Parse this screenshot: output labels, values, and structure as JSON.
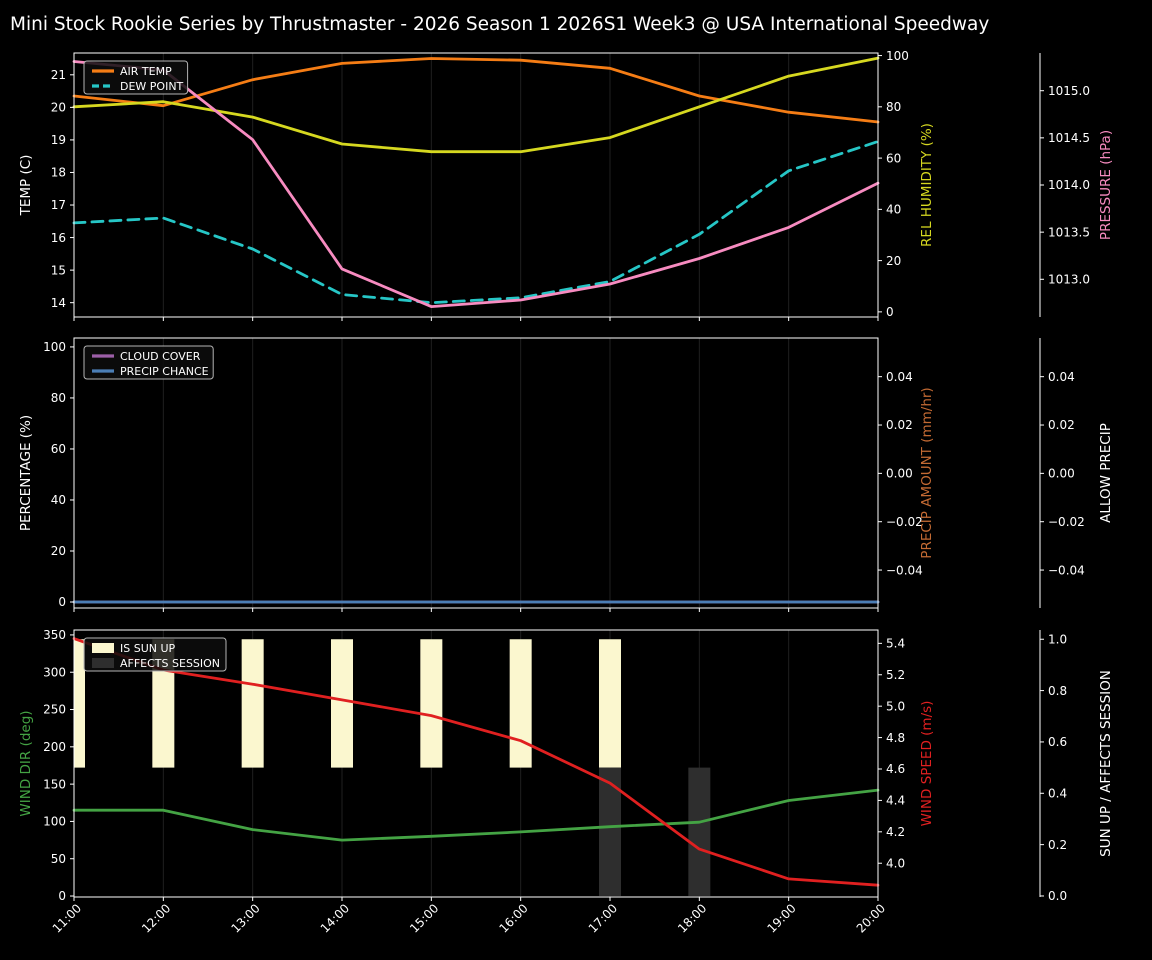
{
  "title": "Mini Stock Rookie Series by Thrustmaster - 2026 Season 1 2026S1 Week3 @ USA International Speedway",
  "x_axis": {
    "hours": [
      11,
      12,
      13,
      14,
      15,
      16,
      17,
      18,
      19,
      20
    ],
    "tick_labels": [
      "11:00",
      "12:00",
      "13:00",
      "14:00",
      "15:00",
      "16:00",
      "17:00",
      "18:00",
      "19:00",
      "20:00"
    ]
  },
  "colors": {
    "background": "#000000",
    "text": "#ffffff",
    "grid": "#202020",
    "spine": "#ffffff",
    "legend_bg": "#0d0d0d",
    "legend_border": "#b5b5b5",
    "air_temp": "#f57d15",
    "dew_point": "#26c6c6",
    "rel_humidity": "#d6d820",
    "pressure": "#f78bc0",
    "cloud_cover": "#9d5fa8",
    "precip_chance": "#4b7eb5",
    "precip_amount": "#c36a33",
    "wind_dir": "#44a344",
    "wind_speed": "#e02020",
    "is_sun_up": "#fbf7cf",
    "affects_session": "#2e2e2e"
  },
  "chart_data": [
    {
      "type": "line",
      "name": "temperature-panel",
      "axes": {
        "left": {
          "label": "TEMP (C)",
          "color_key": "text",
          "ticks": [
            14,
            15,
            16,
            17,
            18,
            19,
            20,
            21
          ],
          "range": [
            13.56,
            21.67
          ],
          "decimals": 0
        },
        "right_inner": {
          "label": "REL HUMIDITY (%)",
          "color_key": "rel_humidity",
          "ticks": [
            0,
            20,
            40,
            60,
            80,
            100
          ],
          "range": [
            -2,
            101
          ],
          "decimals": 0
        },
        "right_outer": {
          "label": "PRESSURE (hPa)",
          "color_key": "pressure",
          "ticks": [
            1013.0,
            1013.5,
            1014.0,
            1014.5,
            1015.0
          ],
          "range": [
            1012.6,
            1015.4
          ],
          "decimals": 1
        }
      },
      "series": [
        {
          "name": "AIR TEMP",
          "axis": "left",
          "color_key": "air_temp",
          "dash": false,
          "in_legend": true,
          "values": [
            20.35,
            20.05,
            20.85,
            21.35,
            21.5,
            21.45,
            21.2,
            20.35,
            19.85,
            19.55
          ]
        },
        {
          "name": "DEW POINT",
          "axis": "left",
          "color_key": "dew_point",
          "dash": true,
          "in_legend": true,
          "values": [
            16.45,
            16.6,
            15.65,
            14.25,
            14.0,
            14.15,
            14.65,
            16.1,
            18.05,
            18.95
          ]
        },
        {
          "name": "REL HUMIDITY",
          "axis": "right_inner",
          "color_key": "rel_humidity",
          "dash": false,
          "in_legend": false,
          "values": [
            80,
            82,
            76,
            65.5,
            62.5,
            62.5,
            68,
            80,
            92,
            99
          ]
        },
        {
          "name": "PRESSURE",
          "axis": "right_outer",
          "color_key": "pressure",
          "dash": false,
          "in_legend": false,
          "values": [
            1015.31,
            1015.22,
            1014.48,
            1013.11,
            1012.71,
            1012.78,
            1012.95,
            1013.22,
            1013.55,
            1014.02
          ]
        }
      ],
      "bars": []
    },
    {
      "type": "line",
      "name": "precipitation-panel",
      "axes": {
        "left": {
          "label": "PERCENTAGE (%)",
          "color_key": "text",
          "ticks": [
            0,
            20,
            40,
            60,
            80,
            100
          ],
          "range": [
            -2.35,
            103.5
          ],
          "decimals": 0
        },
        "right_inner": {
          "label": "PRECIP AMOUNT (mm/hr)",
          "color_key": "precip_amount",
          "ticks": [
            -0.04,
            -0.02,
            0.0,
            0.02,
            0.04
          ],
          "range": [
            -0.0557,
            0.056
          ],
          "decimals": 2
        },
        "right_outer": {
          "label": "ALLOW PRECIP",
          "color_key": "text",
          "ticks": [
            -0.04,
            -0.02,
            0.0,
            0.02,
            0.04
          ],
          "range": [
            -0.0557,
            0.056
          ],
          "decimals": 2
        }
      },
      "series": [
        {
          "name": "CLOUD COVER",
          "axis": "left",
          "color_key": "cloud_cover",
          "dash": false,
          "in_legend": true,
          "values": [
            0,
            0,
            0,
            0,
            0,
            0,
            0,
            0,
            0,
            0
          ]
        },
        {
          "name": "PRECIP CHANCE",
          "axis": "left",
          "color_key": "precip_chance",
          "dash": false,
          "in_legend": true,
          "values": [
            0,
            0,
            0,
            0,
            0,
            0,
            0,
            0,
            0,
            0
          ]
        }
      ],
      "bars": []
    },
    {
      "type": "line",
      "name": "wind-panel",
      "axes": {
        "left": {
          "label": "WIND DIR (deg)",
          "color_key": "wind_dir",
          "ticks": [
            0,
            50,
            100,
            150,
            200,
            250,
            300,
            350
          ],
          "range": [
            -1.3,
            356.6
          ],
          "decimals": 0
        },
        "right_inner": {
          "label": "WIND SPEED (m/s)",
          "color_key": "wind_speed",
          "ticks": [
            4.0,
            4.2,
            4.4,
            4.6,
            4.8,
            5.0,
            5.2,
            5.4
          ],
          "range": [
            3.785,
            5.485
          ],
          "decimals": 1
        },
        "right_outer": {
          "label": "SUN UP / AFFECTS SESSION",
          "color_key": "text",
          "ticks": [
            0.0,
            0.2,
            0.4,
            0.6,
            0.8,
            1.0
          ],
          "range": [
            -0.004,
            1.036
          ],
          "decimals": 1
        }
      },
      "series": [
        {
          "name": "WIND DIR",
          "axis": "left",
          "color_key": "wind_dir",
          "dash": false,
          "in_legend": false,
          "values": [
            115,
            115,
            89,
            75,
            80,
            86,
            93,
            99,
            128,
            142
          ]
        },
        {
          "name": "WIND SPEED",
          "axis": "right_inner",
          "color_key": "wind_speed",
          "dash": false,
          "in_legend": false,
          "values": [
            5.43,
            5.23,
            5.14,
            5.04,
            4.94,
            4.78,
            4.51,
            4.09,
            3.9,
            3.86
          ]
        }
      ],
      "bars": [
        {
          "name": "IS SUN UP",
          "axis": "right_outer",
          "color_key": "is_sun_up",
          "base": 0.5,
          "top": 1.0,
          "in_legend": true,
          "flags": [
            1,
            1,
            1,
            1,
            1,
            1,
            1,
            0,
            0,
            0
          ]
        },
        {
          "name": "AFFECTS SESSION",
          "axis": "right_outer",
          "color_key": "affects_session",
          "base": 0.0,
          "top": 0.5,
          "in_legend": true,
          "flags": [
            0,
            0,
            0,
            0,
            0,
            0,
            1,
            1,
            0,
            0
          ]
        }
      ]
    }
  ]
}
